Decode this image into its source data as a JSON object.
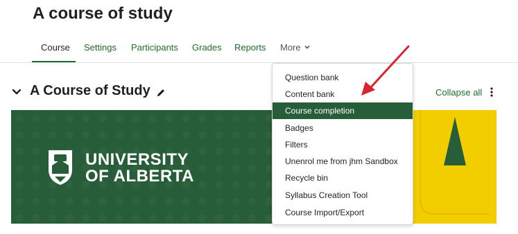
{
  "page": {
    "title": "A course of study"
  },
  "nav": {
    "tabs": [
      {
        "label": "Course"
      },
      {
        "label": "Settings"
      },
      {
        "label": "Participants"
      },
      {
        "label": "Grades"
      },
      {
        "label": "Reports"
      },
      {
        "label": "More"
      }
    ],
    "active_tab": "Course"
  },
  "section": {
    "title": "A Course of Study",
    "collapse_all": "Collapse all"
  },
  "banner": {
    "line1": "UNIVERSITY",
    "line2": "OF ALBERTA",
    "brand_green": "#275d38",
    "brand_gold": "#f2cd00"
  },
  "more_menu": {
    "items": [
      {
        "label": "Question bank"
      },
      {
        "label": "Content bank"
      },
      {
        "label": "Course completion"
      },
      {
        "label": "Badges"
      },
      {
        "label": "Filters"
      },
      {
        "label": "Unenrol me from jhm Sandbox"
      },
      {
        "label": "Recycle bin"
      },
      {
        "label": "Syllabus Creation Tool"
      },
      {
        "label": "Course Import/Export"
      }
    ],
    "highlighted": "Course completion"
  },
  "annotation": {
    "arrow_color": "#d9232e"
  }
}
